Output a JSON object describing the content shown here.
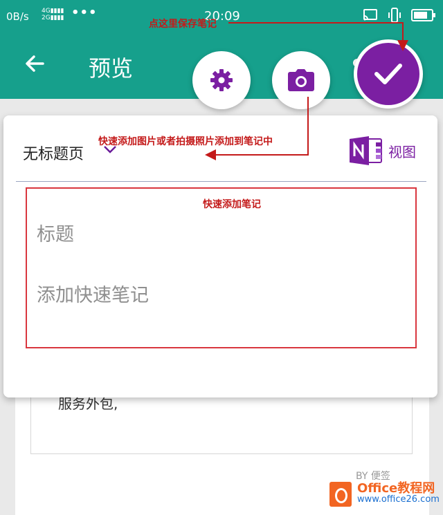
{
  "status_bar": {
    "speed": "0B/s",
    "signal_top": "4G",
    "signal_bottom": "2G",
    "more": "•••",
    "time": "20:09"
  },
  "header": {
    "title": "预览"
  },
  "card": {
    "page_title": "无标题页",
    "view_label": "视图",
    "title_placeholder": "标题",
    "note_placeholder": "添加快速笔记"
  },
  "background_doc": {
    "text": "服务外包,",
    "by": "BY 便签"
  },
  "annotations": {
    "save": "点这里保存笔记",
    "photo": "快速添加图片或者拍摄照片添加到笔记中",
    "quick": "快速添加笔记"
  },
  "watermark": {
    "brand": "Office教程网",
    "url": "www.office26.com"
  },
  "colors": {
    "header_bg": "#16a08c",
    "accent_purple": "#7b1fa2",
    "annotation_red": "#c41a1a"
  }
}
